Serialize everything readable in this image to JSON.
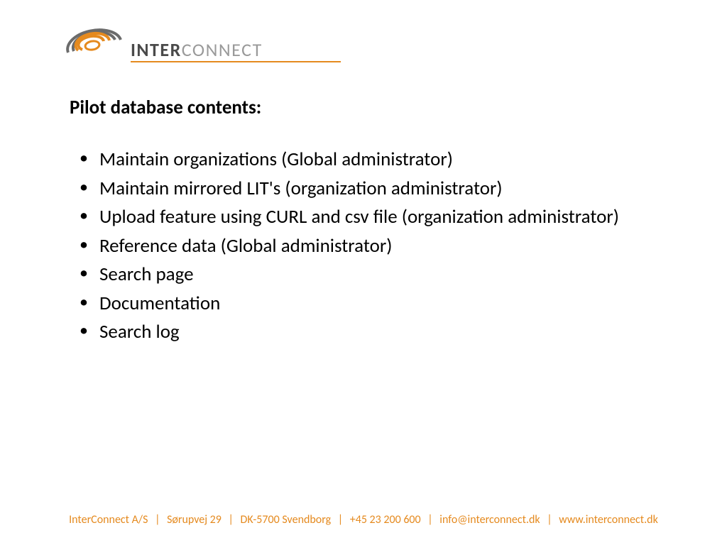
{
  "logo": {
    "part1": "INTER",
    "part2": "CONNECT"
  },
  "heading": "Pilot database contents:",
  "bullets": [
    "Maintain organizations (Global administrator)",
    "Maintain mirrored LIT's (organization administrator)",
    "Upload feature using CURL and csv file (organization administrator)",
    "Reference data (Global administrator)",
    "Search page",
    "Documentation",
    "Search log"
  ],
  "footer": {
    "company": "InterConnect A/S",
    "street": "Sørupvej 29",
    "city": "DK-5700 Svendborg",
    "phone": "+45 23 200 600",
    "email": "info@interconnect.dk",
    "web": "www.interconnect.dk",
    "sep": "|"
  }
}
